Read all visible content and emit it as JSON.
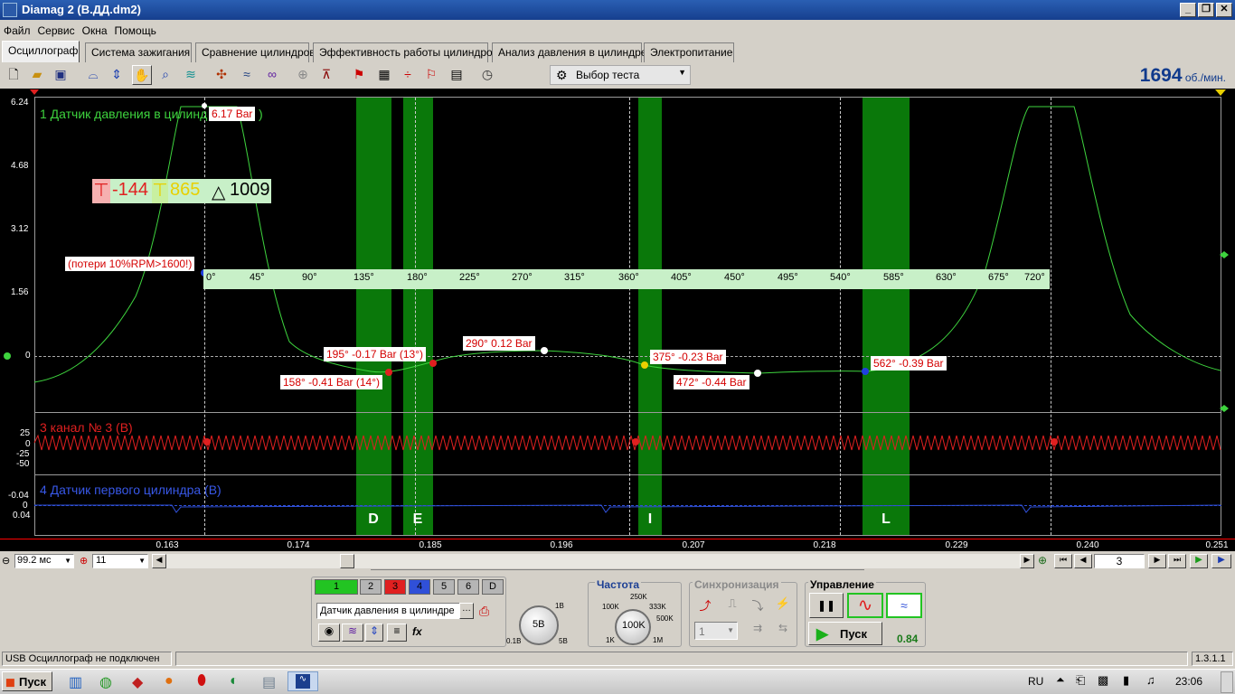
{
  "window": {
    "title": "Diamag 2 (В.ДД.dm2)"
  },
  "menu": [
    "Файл",
    "Сервис",
    "Окна",
    "Помощь"
  ],
  "tabs": [
    "Осциллограф",
    "Система зажигания",
    "Сравнение цилиндров",
    "Эффективность работы цилиндров",
    "Анализ давления в цилиндре",
    "Электропитание"
  ],
  "toolbar": {
    "test_select": "Выбор теста",
    "rpm_value": "1694",
    "rpm_unit": "об./мин."
  },
  "plot": {
    "y_ticks": [
      "6.24",
      "4.68",
      "3.12",
      "1.56",
      "0",
      "25",
      "0",
      "-25",
      "-50",
      "-0.04",
      "0",
      "0.04"
    ],
    "channel1": "1 Датчик давления в цилинд",
    "channel3": "3 канал № 3 (В)",
    "channel4": "4 Датчик первого цилиндра (В)",
    "peak_label": "6.17 Bar",
    "cursor_box": {
      "red": "-144",
      "yellow": "865",
      "delta": "1009"
    },
    "loss_label": "(потери 10%RPM>1600!)",
    "degree_ticks": [
      "0°",
      "45°",
      "90°",
      "135°",
      "180°",
      "225°",
      "270°",
      "315°",
      "360°",
      "405°",
      "450°",
      "495°",
      "540°",
      "585°",
      "630°",
      "675°",
      "720°"
    ],
    "markers": [
      "195° -0.17 Bar (13°)",
      "158° -0.41 Bar (14°)",
      "290° 0.12 Bar",
      "375° -0.23 Bar",
      "472° -0.44 Bar",
      "562° -0.39 Bar"
    ],
    "cylinder_letters": [
      "D",
      "E",
      "I",
      "L"
    ],
    "x_axis": [
      "0.163",
      "0.174",
      "0.185",
      "0.196",
      "0.207",
      "0.218",
      "0.229",
      "0.240",
      "0.251"
    ]
  },
  "scrollbar": {
    "timebase": "99.2 мс",
    "zoom": "11",
    "page": "3"
  },
  "panel": {
    "channels": [
      "1",
      "2",
      "3",
      "4",
      "5",
      "6",
      "D"
    ],
    "channel_colors": [
      "#22c422",
      "#b5b5b5",
      "#e02020",
      "#3050d8",
      "#b5b5b5",
      "#b5b5b5",
      "#b5b5b5"
    ],
    "sensor": "Датчик давления в цилиндре",
    "voltage_knob": "5B",
    "voltage_labels": [
      "1B",
      "0.1B",
      "5B"
    ],
    "freq_title": "Частота",
    "freq_knob": "100K",
    "freq_labels": [
      "250K",
      "100K",
      "333K",
      "500K",
      "1K",
      "1M"
    ],
    "sync_title": "Синхронизация",
    "sync_value": "1",
    "control_title": "Управление",
    "start_label": "Пуск",
    "control_value": "0.84"
  },
  "status": {
    "text": "USB Осциллограф не подключен",
    "version": "1.3.1.1"
  },
  "taskbar": {
    "start": "Пуск",
    "lang": "RU",
    "time": "23:06"
  }
}
